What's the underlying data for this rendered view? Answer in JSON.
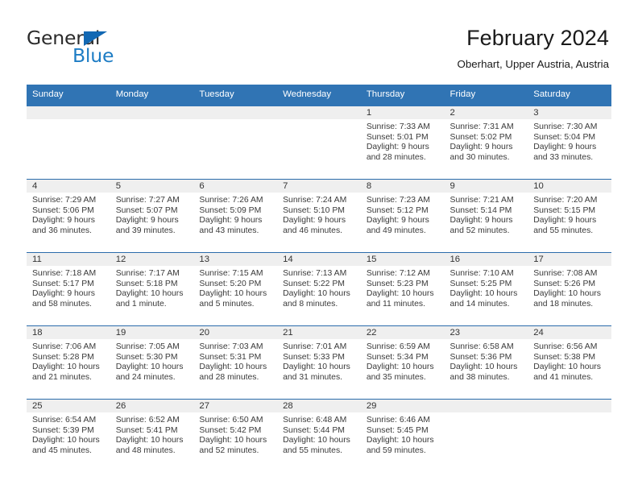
{
  "brand": {
    "name_top": "General",
    "name_bottom": "Blue"
  },
  "header": {
    "title": "February 2024",
    "location": "Oberhart, Upper Austria, Austria"
  },
  "colors": {
    "header_blue": "#3074b4",
    "row_divider": "#2b6cab",
    "daynum_band": "#efefef",
    "logo_blue": "#1d7cc4",
    "text": "#333333"
  },
  "weekday_headers": [
    "Sunday",
    "Monday",
    "Tuesday",
    "Wednesday",
    "Thursday",
    "Friday",
    "Saturday"
  ],
  "labels": {
    "sunrise_prefix": "Sunrise:",
    "sunset_prefix": "Sunset:",
    "daylight_prefix": "Daylight:"
  },
  "weeks": [
    [
      {
        "day": "",
        "empty": true
      },
      {
        "day": "",
        "empty": true
      },
      {
        "day": "",
        "empty": true
      },
      {
        "day": "",
        "empty": true
      },
      {
        "day": "1",
        "sunrise": "Sunrise: 7:33 AM",
        "sunset": "Sunset: 5:01 PM",
        "daylight1": "Daylight: 9 hours",
        "daylight2": "and 28 minutes."
      },
      {
        "day": "2",
        "sunrise": "Sunrise: 7:31 AM",
        "sunset": "Sunset: 5:02 PM",
        "daylight1": "Daylight: 9 hours",
        "daylight2": "and 30 minutes."
      },
      {
        "day": "3",
        "sunrise": "Sunrise: 7:30 AM",
        "sunset": "Sunset: 5:04 PM",
        "daylight1": "Daylight: 9 hours",
        "daylight2": "and 33 minutes."
      }
    ],
    [
      {
        "day": "4",
        "sunrise": "Sunrise: 7:29 AM",
        "sunset": "Sunset: 5:06 PM",
        "daylight1": "Daylight: 9 hours",
        "daylight2": "and 36 minutes."
      },
      {
        "day": "5",
        "sunrise": "Sunrise: 7:27 AM",
        "sunset": "Sunset: 5:07 PM",
        "daylight1": "Daylight: 9 hours",
        "daylight2": "and 39 minutes."
      },
      {
        "day": "6",
        "sunrise": "Sunrise: 7:26 AM",
        "sunset": "Sunset: 5:09 PM",
        "daylight1": "Daylight: 9 hours",
        "daylight2": "and 43 minutes."
      },
      {
        "day": "7",
        "sunrise": "Sunrise: 7:24 AM",
        "sunset": "Sunset: 5:10 PM",
        "daylight1": "Daylight: 9 hours",
        "daylight2": "and 46 minutes."
      },
      {
        "day": "8",
        "sunrise": "Sunrise: 7:23 AM",
        "sunset": "Sunset: 5:12 PM",
        "daylight1": "Daylight: 9 hours",
        "daylight2": "and 49 minutes."
      },
      {
        "day": "9",
        "sunrise": "Sunrise: 7:21 AM",
        "sunset": "Sunset: 5:14 PM",
        "daylight1": "Daylight: 9 hours",
        "daylight2": "and 52 minutes."
      },
      {
        "day": "10",
        "sunrise": "Sunrise: 7:20 AM",
        "sunset": "Sunset: 5:15 PM",
        "daylight1": "Daylight: 9 hours",
        "daylight2": "and 55 minutes."
      }
    ],
    [
      {
        "day": "11",
        "sunrise": "Sunrise: 7:18 AM",
        "sunset": "Sunset: 5:17 PM",
        "daylight1": "Daylight: 9 hours",
        "daylight2": "and 58 minutes."
      },
      {
        "day": "12",
        "sunrise": "Sunrise: 7:17 AM",
        "sunset": "Sunset: 5:18 PM",
        "daylight1": "Daylight: 10 hours",
        "daylight2": "and 1 minute."
      },
      {
        "day": "13",
        "sunrise": "Sunrise: 7:15 AM",
        "sunset": "Sunset: 5:20 PM",
        "daylight1": "Daylight: 10 hours",
        "daylight2": "and 5 minutes."
      },
      {
        "day": "14",
        "sunrise": "Sunrise: 7:13 AM",
        "sunset": "Sunset: 5:22 PM",
        "daylight1": "Daylight: 10 hours",
        "daylight2": "and 8 minutes."
      },
      {
        "day": "15",
        "sunrise": "Sunrise: 7:12 AM",
        "sunset": "Sunset: 5:23 PM",
        "daylight1": "Daylight: 10 hours",
        "daylight2": "and 11 minutes."
      },
      {
        "day": "16",
        "sunrise": "Sunrise: 7:10 AM",
        "sunset": "Sunset: 5:25 PM",
        "daylight1": "Daylight: 10 hours",
        "daylight2": "and 14 minutes."
      },
      {
        "day": "17",
        "sunrise": "Sunrise: 7:08 AM",
        "sunset": "Sunset: 5:26 PM",
        "daylight1": "Daylight: 10 hours",
        "daylight2": "and 18 minutes."
      }
    ],
    [
      {
        "day": "18",
        "sunrise": "Sunrise: 7:06 AM",
        "sunset": "Sunset: 5:28 PM",
        "daylight1": "Daylight: 10 hours",
        "daylight2": "and 21 minutes."
      },
      {
        "day": "19",
        "sunrise": "Sunrise: 7:05 AM",
        "sunset": "Sunset: 5:30 PM",
        "daylight1": "Daylight: 10 hours",
        "daylight2": "and 24 minutes."
      },
      {
        "day": "20",
        "sunrise": "Sunrise: 7:03 AM",
        "sunset": "Sunset: 5:31 PM",
        "daylight1": "Daylight: 10 hours",
        "daylight2": "and 28 minutes."
      },
      {
        "day": "21",
        "sunrise": "Sunrise: 7:01 AM",
        "sunset": "Sunset: 5:33 PM",
        "daylight1": "Daylight: 10 hours",
        "daylight2": "and 31 minutes."
      },
      {
        "day": "22",
        "sunrise": "Sunrise: 6:59 AM",
        "sunset": "Sunset: 5:34 PM",
        "daylight1": "Daylight: 10 hours",
        "daylight2": "and 35 minutes."
      },
      {
        "day": "23",
        "sunrise": "Sunrise: 6:58 AM",
        "sunset": "Sunset: 5:36 PM",
        "daylight1": "Daylight: 10 hours",
        "daylight2": "and 38 minutes."
      },
      {
        "day": "24",
        "sunrise": "Sunrise: 6:56 AM",
        "sunset": "Sunset: 5:38 PM",
        "daylight1": "Daylight: 10 hours",
        "daylight2": "and 41 minutes."
      }
    ],
    [
      {
        "day": "25",
        "sunrise": "Sunrise: 6:54 AM",
        "sunset": "Sunset: 5:39 PM",
        "daylight1": "Daylight: 10 hours",
        "daylight2": "and 45 minutes."
      },
      {
        "day": "26",
        "sunrise": "Sunrise: 6:52 AM",
        "sunset": "Sunset: 5:41 PM",
        "daylight1": "Daylight: 10 hours",
        "daylight2": "and 48 minutes."
      },
      {
        "day": "27",
        "sunrise": "Sunrise: 6:50 AM",
        "sunset": "Sunset: 5:42 PM",
        "daylight1": "Daylight: 10 hours",
        "daylight2": "and 52 minutes."
      },
      {
        "day": "28",
        "sunrise": "Sunrise: 6:48 AM",
        "sunset": "Sunset: 5:44 PM",
        "daylight1": "Daylight: 10 hours",
        "daylight2": "and 55 minutes."
      },
      {
        "day": "29",
        "sunrise": "Sunrise: 6:46 AM",
        "sunset": "Sunset: 5:45 PM",
        "daylight1": "Daylight: 10 hours",
        "daylight2": "and 59 minutes."
      },
      {
        "day": "",
        "empty": true
      },
      {
        "day": "",
        "empty": true
      }
    ]
  ]
}
